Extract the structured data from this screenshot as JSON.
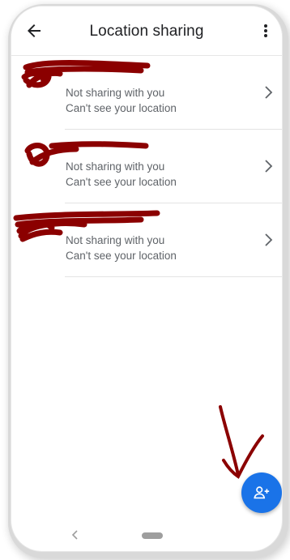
{
  "appbar": {
    "title": "Location sharing",
    "back_icon": "arrow-left-icon",
    "menu_icon": "more-vert-icon"
  },
  "contacts": [
    {
      "status": "Not sharing with you",
      "visibility": "Can't see your location"
    },
    {
      "status": "Not sharing with you",
      "visibility": "Can't see your location"
    },
    {
      "status": "Not sharing with you",
      "visibility": "Can't see your location"
    }
  ],
  "fab": {
    "icon": "person-add-icon",
    "color": "#1a73e8"
  },
  "annotation": {
    "color": "#8b0000"
  },
  "navbar": {
    "back_icon": "chevron-left-icon",
    "home_icon": "home-pill-icon"
  }
}
